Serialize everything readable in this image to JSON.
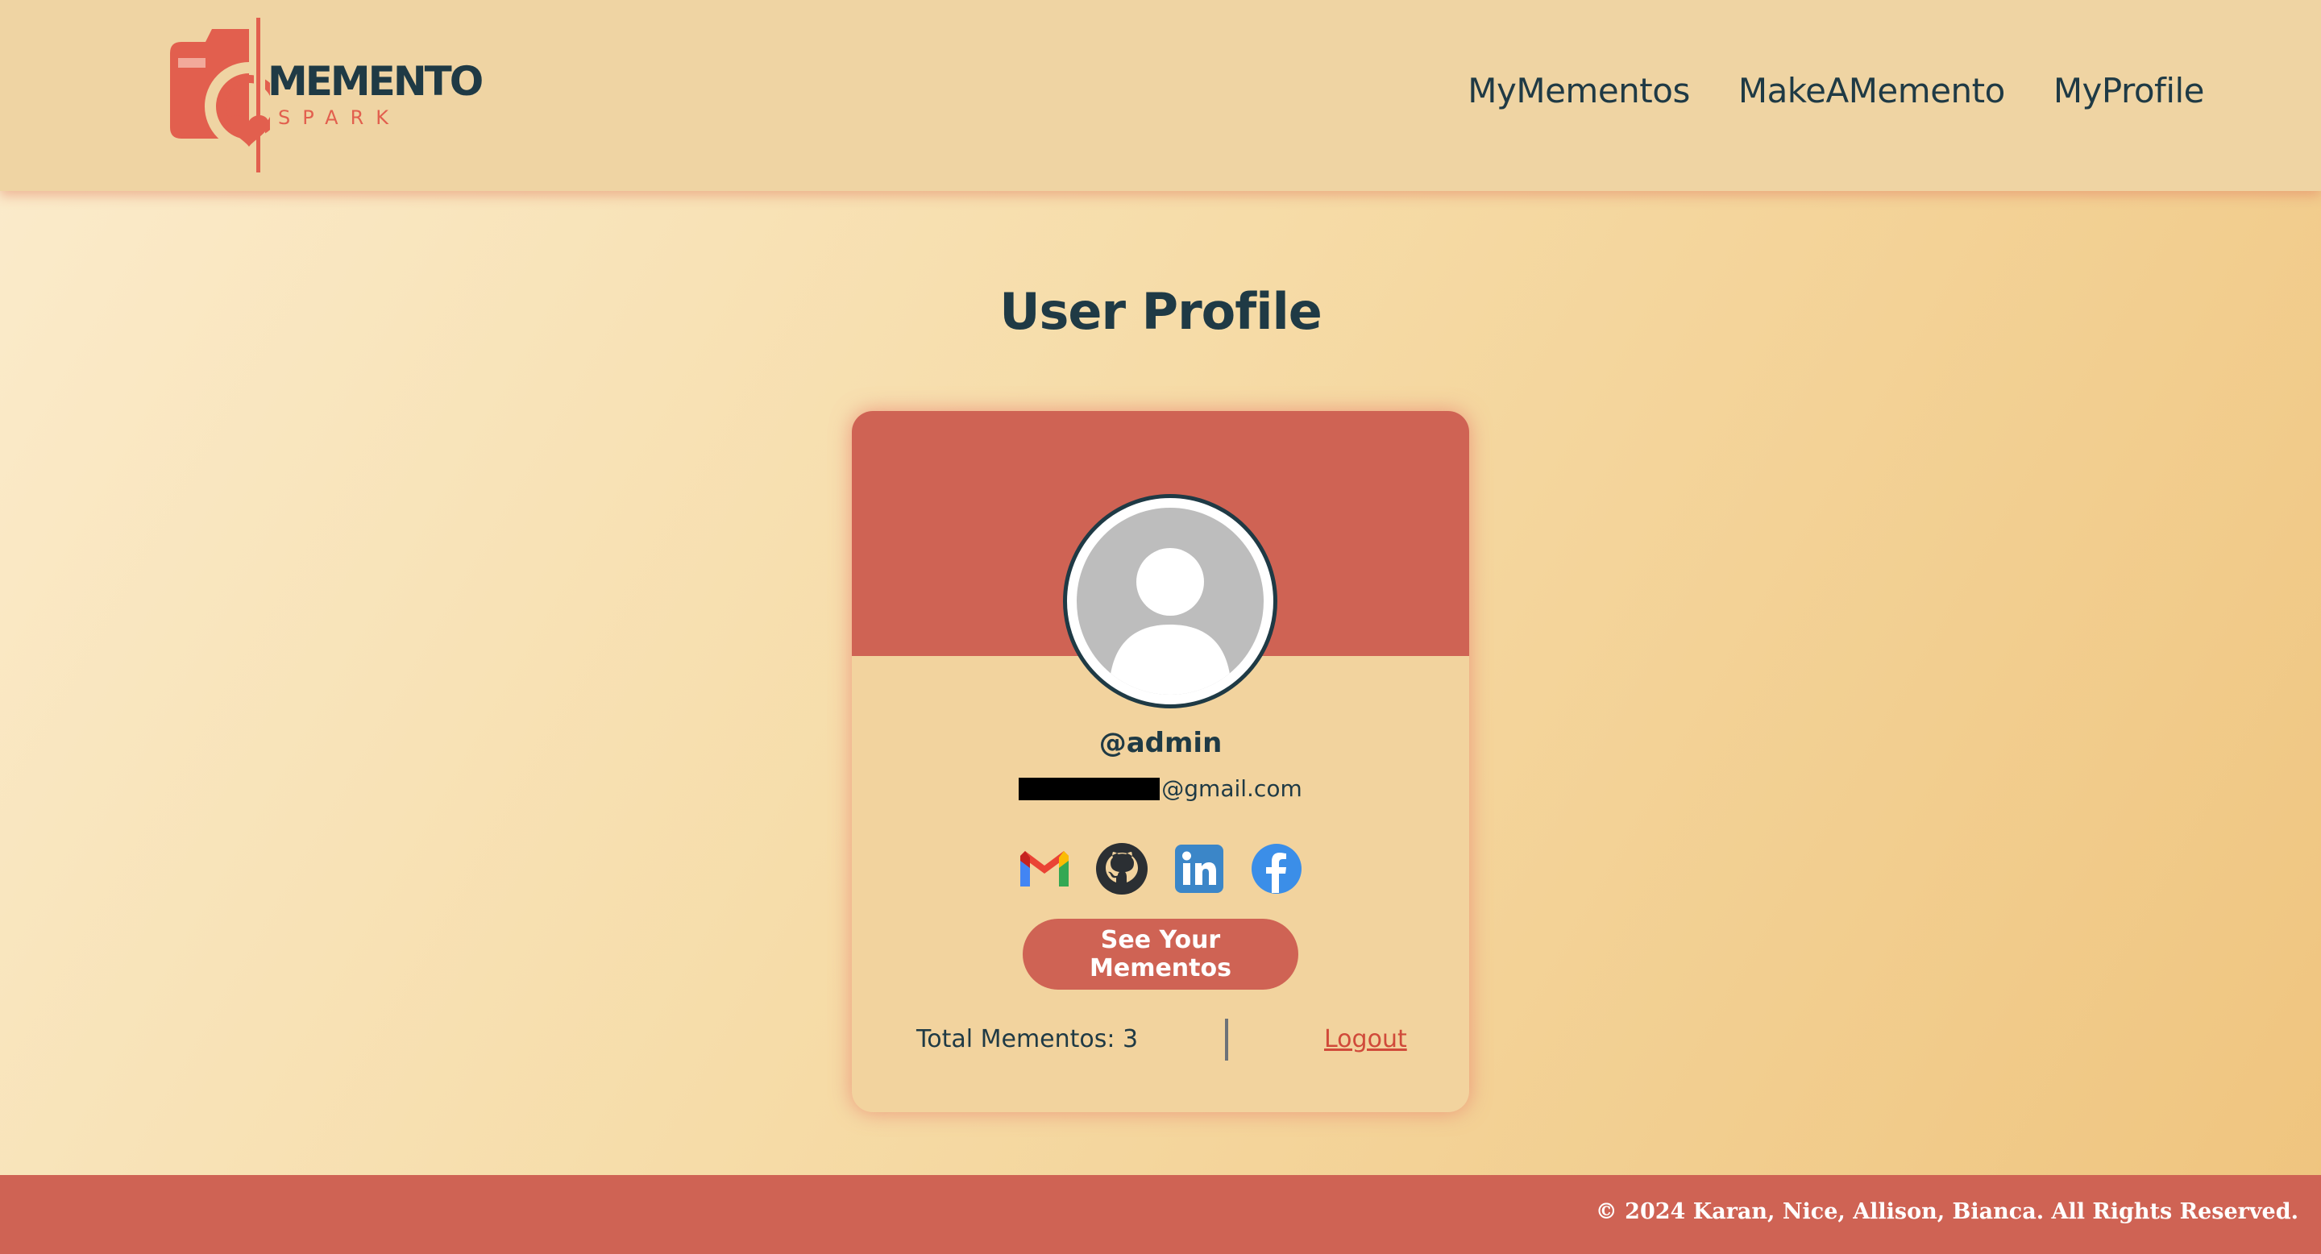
{
  "brand": {
    "word1": "MEMENTO",
    "word2": "SPARK",
    "accent": "#e25f4e",
    "dark": "#1f3a45"
  },
  "nav": {
    "items": [
      {
        "label": "MyMementos"
      },
      {
        "label": "MakeAMemento"
      },
      {
        "label": "MyProfile"
      }
    ]
  },
  "page": {
    "title": "User Profile"
  },
  "profile": {
    "username": "@admin",
    "email_suffix": "@gmail.com",
    "socials": [
      "gmail-icon",
      "github-icon",
      "linkedin-icon",
      "facebook-icon"
    ],
    "cta_label": "See Your Mementos",
    "total_label": "Total Mementos: 3",
    "logout_label": "Logout"
  },
  "footer": {
    "text": "© 2024 Karan, Nice, Allison, Bianca. All Rights Reserved."
  },
  "colors": {
    "header_bg": "#efd4a3",
    "card_banner": "#cf6354",
    "footer_bg": "#cf6354",
    "text_dark": "#1f3a45"
  }
}
